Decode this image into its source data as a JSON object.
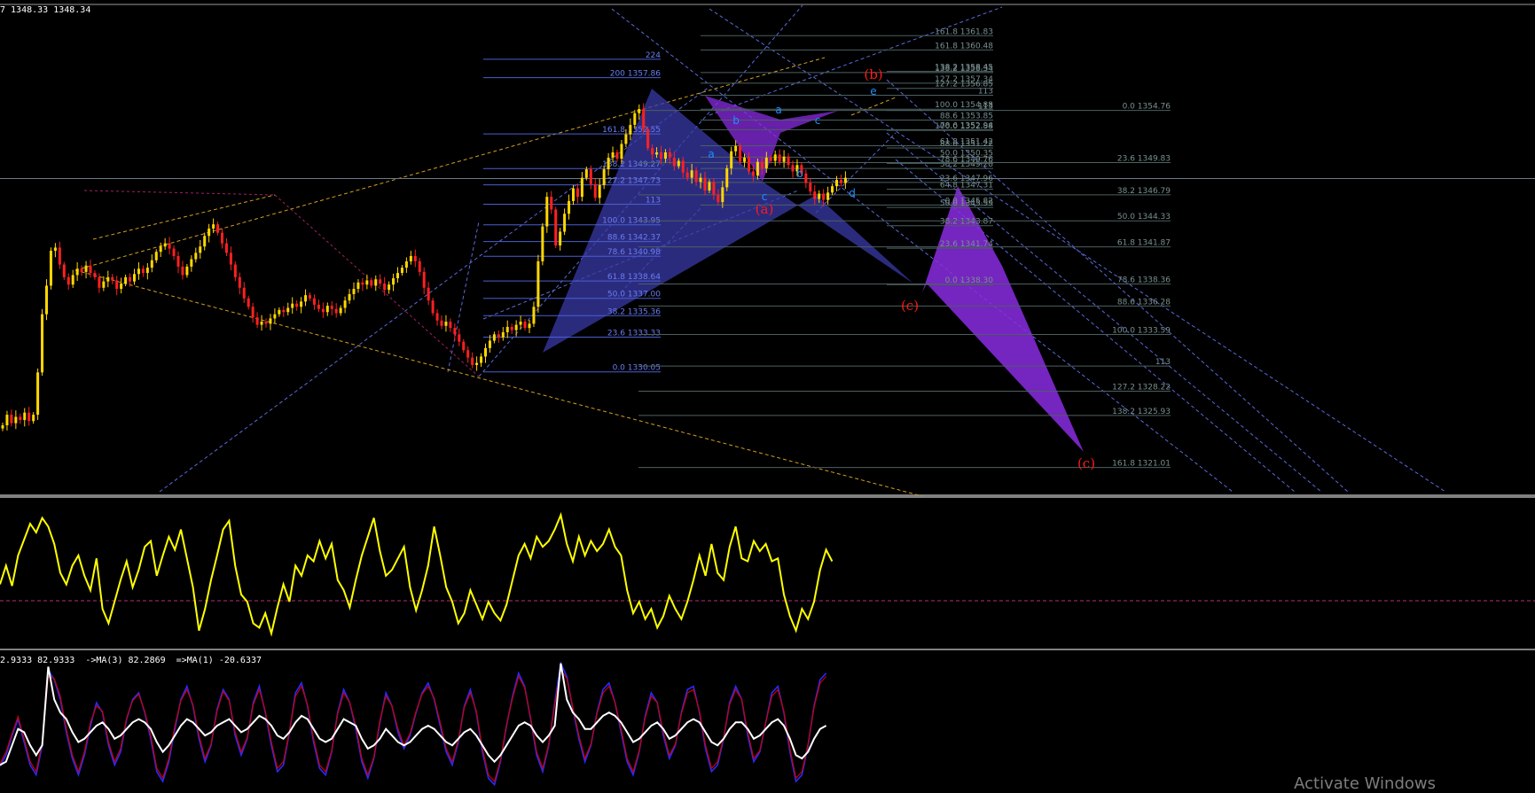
{
  "window": {
    "main_header": "7 1348.33 1348.34",
    "sub2_header": "2.9333 82.9333  ->MA(3) 82.2869  =>MA(1) -20.6337",
    "watermark": "Activate Windows"
  },
  "colors": {
    "background": "#000000",
    "candle_up": "#ffd700",
    "candle_down": "#ff2020",
    "fib_blue": "#4a5fd0",
    "fib_gray": "#4c6060",
    "wave_red": "#ff1a1a",
    "pattern_label": "#1e90ff",
    "harmonic_blue": "#3a3aa8",
    "harmonic_purple": "#8a2be2",
    "trend_orange": "#d4a020",
    "osc_yellow": "#ffff00",
    "osc2_white": "#ffffff",
    "osc2_blue": "#2a2aff",
    "osc2_red": "#c80000",
    "panel_separator": "#808080",
    "price_line": "#6b7a8a",
    "zero_line": "#b0307a"
  },
  "fib_set_1": [
    {
      "label": "224",
      "price": 1359.6
    },
    {
      "label": "200 1357.86",
      "price": 1357.86
    },
    {
      "label": "161.8 1352.55",
      "price": 1352.55
    },
    {
      "label": "138.2 1349.27",
      "price": 1349.27
    },
    {
      "label": "127.2 1347.73",
      "price": 1347.73
    },
    {
      "label": "113",
      "price": 1345.9
    },
    {
      "label": "100.0 1343.95",
      "price": 1343.95
    },
    {
      "label": "88.6 1342.37",
      "price": 1342.37
    },
    {
      "label": "78.6 1340.98",
      "price": 1340.98
    },
    {
      "label": "61.8 1338.64",
      "price": 1338.64
    },
    {
      "label": "50.0 1337.00",
      "price": 1337.0
    },
    {
      "label": "38.2 1335.36",
      "price": 1335.36
    },
    {
      "label": "23.6 1333.33",
      "price": 1333.33
    },
    {
      "label": "0.0 1330.05",
      "price": 1330.05
    }
  ],
  "fib_set_2": [
    {
      "label": "161.8 1361.83",
      "price": 1361.83
    },
    {
      "label": "161.8 1360.48",
      "price": 1360.48
    },
    {
      "label": "138.2 1358.34",
      "price": 1358.34
    },
    {
      "label": "127.2 1357.34",
      "price": 1357.34
    },
    {
      "label": "113",
      "price": 1356.2
    },
    {
      "label": "100.0 1354.88",
      "price": 1354.88
    },
    {
      "label": "88.6 1353.85",
      "price": 1353.85
    },
    {
      "label": "78.6 1352.94",
      "price": 1352.94
    },
    {
      "label": "61.8 1351.42",
      "price": 1351.42
    },
    {
      "label": "50.0 1350.35",
      "price": 1350.35
    },
    {
      "label": "38.2 1349.28",
      "price": 1349.28
    },
    {
      "label": "23.6 1347.96",
      "price": 1347.96
    },
    {
      "label": "0.0 1345.82",
      "price": 1345.82
    }
  ],
  "fib_set_3": [
    {
      "label": "138.2 1358.45",
      "price": 1358.45
    },
    {
      "label": "127.2 1356.85",
      "price": 1356.85
    },
    {
      "label": "113",
      "price": 1354.76
    },
    {
      "label": "100.0 1352.88",
      "price": 1352.88
    },
    {
      "label": "88.6 1351.22",
      "price": 1351.22
    },
    {
      "label": "78.6 1349.76",
      "price": 1349.76
    },
    {
      "label": "64.8 1347.31",
      "price": 1347.31
    },
    {
      "label": "50.0 1345.59",
      "price": 1345.59
    },
    {
      "label": "38.2 1343.87",
      "price": 1343.87
    },
    {
      "label": "23.6 1341.74",
      "price": 1341.74
    },
    {
      "label": "0.0 1338.30",
      "price": 1338.3
    }
  ],
  "fib_set_4": [
    {
      "label": "0.0 1354.76",
      "price": 1354.76
    },
    {
      "label": "23.6 1349.83",
      "price": 1349.83
    },
    {
      "label": "38.2 1346.79",
      "price": 1346.79
    },
    {
      "label": "50.0 1344.33",
      "price": 1344.33
    },
    {
      "label": "61.8 1341.87",
      "price": 1341.87
    },
    {
      "label": "78.6 1338.36",
      "price": 1338.36
    },
    {
      "label": "88.6 1336.28",
      "price": 1336.28
    },
    {
      "label": "100.0 1333.59",
      "price": 1333.59
    },
    {
      "label": "113",
      "price": 1330.6
    },
    {
      "label": "127.2 1328.22",
      "price": 1328.22
    },
    {
      "label": "138.2 1325.93",
      "price": 1325.93
    },
    {
      "label": "161.8 1321.01",
      "price": 1321.01
    }
  ],
  "wave_labels": [
    "(a)",
    "(b)",
    "(c)",
    "(c)"
  ],
  "pattern_labels": [
    "a",
    "b",
    "c",
    "d",
    "e",
    "a",
    "b",
    "c"
  ],
  "chart_data": [
    {
      "type": "candlestick",
      "title": "",
      "ylim": [
        1318.3,
        1364.7
      ],
      "current_price": 1348.33,
      "series": [
        {
          "values": [
            1325.0,
            1326.0,
            1325.2,
            1325.8,
            1325.5,
            1326.2,
            1325.4,
            1326.0,
            1330.0,
            1335.5,
            1338.2,
            1341.5,
            1341.8,
            1340.2,
            1339.0,
            1338.3,
            1339.2,
            1339.8,
            1339.5,
            1340.1,
            1339.4,
            1339.0,
            1338.0,
            1338.6,
            1339.0,
            1338.7,
            1337.9,
            1338.4,
            1339.0,
            1338.6,
            1339.3,
            1339.8,
            1339.4,
            1339.9,
            1340.6,
            1341.4,
            1341.9,
            1342.2,
            1341.7,
            1341.0,
            1340.0,
            1339.2,
            1340.0,
            1340.7,
            1341.3,
            1341.9,
            1342.9,
            1343.6,
            1344.0,
            1343.2,
            1342.2,
            1341.3,
            1340.2,
            1339.0,
            1338.0,
            1337.0,
            1336.2,
            1335.2,
            1334.5,
            1334.8,
            1334.6,
            1335.1,
            1335.5,
            1335.9,
            1335.7,
            1336.1,
            1336.5,
            1336.2,
            1336.7,
            1337.3,
            1337.0,
            1336.4,
            1336.0,
            1335.7,
            1336.3,
            1336.0,
            1335.6,
            1336.1,
            1336.8,
            1337.4,
            1337.9,
            1338.5,
            1338.3,
            1338.7,
            1338.2,
            1338.8,
            1338.4,
            1337.8,
            1338.3,
            1338.9,
            1339.4,
            1339.9,
            1340.5,
            1341.0,
            1340.5,
            1339.5,
            1338.0,
            1336.8,
            1335.6,
            1334.9,
            1334.4,
            1334.8,
            1334.2,
            1333.6,
            1332.9,
            1332.1,
            1331.4,
            1330.7,
            1330.9,
            1331.5,
            1332.3,
            1333.0,
            1333.6,
            1333.3,
            1333.8,
            1334.3,
            1334.0,
            1334.5,
            1334.8,
            1334.2,
            1334.6,
            1336.2,
            1340.5,
            1343.8,
            1346.6,
            1345.4,
            1342.0,
            1343.3,
            1345.0,
            1346.2,
            1347.4,
            1346.6,
            1348.4,
            1349.2,
            1347.8,
            1346.5,
            1347.7,
            1349.2,
            1350.3,
            1350.8,
            1350.2,
            1351.6,
            1352.5,
            1353.4,
            1354.5,
            1354.9,
            1353.0,
            1351.2,
            1350.6,
            1350.8,
            1350.2,
            1350.8,
            1350.3,
            1349.5,
            1350.0,
            1348.9,
            1348.4,
            1349.1,
            1348.0,
            1348.4,
            1347.2,
            1348.0,
            1346.8,
            1346.1,
            1347.5,
            1349.3,
            1350.9,
            1351.4,
            1349.9,
            1350.3,
            1349.0,
            1348.6,
            1349.9,
            1349.3,
            1350.3,
            1350.0,
            1350.6,
            1349.9,
            1350.4,
            1349.6,
            1349.0,
            1349.6,
            1348.8,
            1347.9,
            1347.1,
            1346.4,
            1346.9,
            1346.3,
            1347.0,
            1347.6,
            1348.2,
            1347.9,
            1348.4
          ]
        }
      ]
    },
    {
      "type": "line",
      "title": "",
      "ylim": [
        0,
        100
      ],
      "series": [
        {
          "values": [
            42.0,
            55.0,
            41.0,
            62.0,
            73.0,
            84.0,
            78.0,
            88.0,
            82.0,
            70.0,
            50.0,
            42.0,
            55.0,
            62.0,
            48.0,
            38.0,
            60.0,
            25.0,
            15.0,
            30.0,
            45.0,
            58.0,
            40.0,
            52.0,
            68.0,
            72.0,
            48.0,
            62.0,
            75.0,
            66.0,
            80.0,
            60.0,
            40.0,
            10.0,
            25.0,
            45.0,
            62.0,
            80.0,
            86.0,
            55.0,
            35.0,
            30.0,
            15.0,
            12.0,
            22.0,
            8.0,
            26.0,
            42.0,
            30.0,
            55.0,
            48.0,
            62.0,
            58.0,
            72.0,
            60.0,
            70.0,
            45.0,
            38.0,
            26.0,
            45.0,
            62.0,
            75.0,
            88.0,
            65.0,
            48.0,
            52.0,
            60.0,
            68.0,
            40.0,
            24.0,
            38.0,
            55.0,
            82.0,
            62.0,
            40.0,
            30.0,
            15.0,
            22.0,
            38.0,
            28.0,
            18.0,
            30.0,
            22.0,
            17.0,
            28.0,
            45.0,
            62.0,
            70.0,
            60.0,
            75.0,
            68.0,
            72.0,
            80.0,
            90.0,
            70.0,
            58.0,
            75.0,
            62.0,
            72.0,
            65.0,
            70.0,
            80.0,
            68.0,
            62.0,
            38.0,
            22.0,
            30.0,
            18.0,
            25.0,
            12.0,
            20.0,
            34.0,
            25.0,
            18.0,
            30.0,
            45.0,
            62.0,
            48.0,
            70.0,
            50.0,
            45.0,
            68.0,
            82.0,
            60.0,
            58.0,
            72.0,
            65.0,
            70.0,
            58.0,
            60.0,
            35.0,
            20.0,
            10.0,
            25.0,
            18.0,
            30.0,
            52.0,
            66.0,
            58.0
          ]
        }
      ]
    },
    {
      "type": "line",
      "title": "",
      "ylim": [
        -100,
        100
      ],
      "series": [
        {
          "values": [
            -62.0,
            -45.0,
            -15.0,
            10.0,
            -25.0,
            -60.0,
            -75.0,
            -30.0,
            85.0,
            70.0,
            40.0,
            -10.0,
            -50.0,
            -75.0,
            -45.0,
            0.0,
            35.0,
            20.0,
            -30.0,
            -60.0,
            -40.0,
            10.0,
            40.0,
            50.0,
            20.0,
            -20.0,
            -70.0,
            -85.0,
            -55.0,
            -5.0,
            40.0,
            60.0,
            30.0,
            -20.0,
            -55.0,
            -30.0,
            25.0,
            55.0,
            40.0,
            -15.0,
            -45.0,
            -20.0,
            35.0,
            60.0,
            20.0,
            -30.0,
            -70.0,
            -60.0,
            -10.0,
            50.0,
            65.0,
            30.0,
            -25.0,
            -65.0,
            -75.0,
            -40.0,
            20.0,
            55.0,
            35.0,
            -5.0,
            -55.0,
            -80.0,
            -50.0,
            5.0,
            50.0,
            30.0,
            -10.0,
            -35.0,
            -15.0,
            20.0,
            50.0,
            65.0,
            40.0,
            0.0,
            -40.0,
            -60.0,
            -25.0,
            30.0,
            55.0,
            20.0,
            -40.0,
            -80.0,
            -90.0,
            -55.0,
            0.0,
            45.0,
            80.0,
            60.0,
            10.0,
            -45.0,
            -70.0,
            -30.0,
            35.0,
            95.0,
            75.0,
            25.0,
            -20.0,
            -55.0,
            -30.0,
            20.0,
            55.0,
            65.0,
            35.0,
            -10.0,
            -55.0,
            -75.0,
            -40.0,
            15.0,
            50.0,
            35.0,
            -15.0,
            -50.0,
            -30.0,
            20.0,
            55.0,
            60.0,
            20.0,
            -35.0,
            -70.0,
            -60.0,
            -20.0,
            35.0,
            60.0,
            40.0,
            -15.0,
            -55.0,
            -40.0,
            5.0,
            50.0,
            60.0,
            20.0,
            -40.0,
            -85.0,
            -75.0,
            -30.0,
            30.0,
            70.0,
            80.0
          ]
        },
        {
          "values": [
            -58.0,
            -40.0,
            -12.0,
            14.0,
            -20.0,
            -55.0,
            -70.0,
            -25.0,
            75.0,
            72.0,
            45.0,
            -5.0,
            -45.0,
            -70.0,
            -40.0,
            5.0,
            30.0,
            22.0,
            -25.0,
            -55.0,
            -35.0,
            12.0,
            38.0,
            48.0,
            22.0,
            -15.0,
            -65.0,
            -80.0,
            -50.0,
            0.0,
            38.0,
            55.0,
            32.0,
            -15.0,
            -50.0,
            -28.0,
            22.0,
            52.0,
            38.0,
            -10.0,
            -40.0,
            -18.0,
            32.0,
            55.0,
            22.0,
            -25.0,
            -65.0,
            -55.0,
            -8.0,
            45.0,
            60.0,
            32.0,
            -20.0,
            -60.0,
            -70.0,
            -38.0,
            18.0,
            50.0,
            35.0,
            0.0,
            -50.0,
            -75.0,
            -48.0,
            8.0,
            45.0,
            30.0,
            -5.0,
            -30.0,
            -12.0,
            22.0,
            48.0,
            60.0,
            42.0,
            5.0,
            -35.0,
            -55.0,
            -22.0,
            28.0,
            50.0,
            22.0,
            -35.0,
            -75.0,
            -85.0,
            -52.0,
            2.0,
            42.0,
            75.0,
            58.0,
            12.0,
            -40.0,
            -65.0,
            -28.0,
            32.0,
            85.0,
            72.0,
            28.0,
            -15.0,
            -50.0,
            -28.0,
            18.0,
            50.0,
            60.0,
            35.0,
            -5.0,
            -50.0,
            -70.0,
            -38.0,
            12.0,
            45.0,
            35.0,
            -10.0,
            -45.0,
            -28.0,
            18.0,
            50.0,
            55.0,
            22.0,
            -30.0,
            -65.0,
            -55.0,
            -18.0,
            32.0,
            55.0,
            40.0,
            -10.0,
            -50.0,
            -38.0,
            5.0,
            45.0,
            55.0,
            22.0,
            -35.0,
            -80.0,
            -70.0,
            -28.0,
            28.0,
            65.0,
            75.0
          ]
        },
        {
          "values": [
            -60.0,
            -55.0,
            -30.0,
            -5.0,
            -10.0,
            -30.0,
            -45.0,
            -30.0,
            90.0,
            40.0,
            20.0,
            10.0,
            -10.0,
            -25.0,
            -20.0,
            -10.0,
            0.0,
            5.0,
            -5.0,
            -20.0,
            -15.0,
            -5.0,
            5.0,
            10.0,
            5.0,
            -5.0,
            -25.0,
            -40.0,
            -30.0,
            -15.0,
            0.0,
            10.0,
            5.0,
            -5.0,
            -15.0,
            -10.0,
            0.0,
            5.0,
            10.0,
            0.0,
            -10.0,
            -5.0,
            5.0,
            15.0,
            10.0,
            0.0,
            -15.0,
            -20.0,
            -10.0,
            5.0,
            15.0,
            10.0,
            -5.0,
            -20.0,
            -25.0,
            -20.0,
            -5.0,
            10.0,
            5.0,
            0.0,
            -20.0,
            -35.0,
            -30.0,
            -20.0,
            -5.0,
            -15.0,
            -25.0,
            -30.0,
            -25.0,
            -15.0,
            -5.0,
            0.0,
            -5.0,
            -15.0,
            -25.0,
            -30.0,
            -20.0,
            -10.0,
            -5.0,
            -15.0,
            -30.0,
            -45.0,
            -55.0,
            -45.0,
            -30.0,
            -15.0,
            0.0,
            5.0,
            0.0,
            -15.0,
            -25.0,
            -15.0,
            0.0,
            95.0,
            40.0,
            20.0,
            10.0,
            -5.0,
            -5.0,
            5.0,
            15.0,
            20.0,
            15.0,
            5.0,
            -10.0,
            -25.0,
            -20.0,
            -10.0,
            0.0,
            5.0,
            -5.0,
            -20.0,
            -15.0,
            -5.0,
            5.0,
            10.0,
            5.0,
            -10.0,
            -25.0,
            -30.0,
            -20.0,
            -5.0,
            5.0,
            5.0,
            -5.0,
            -20.0,
            -15.0,
            -5.0,
            5.0,
            10.0,
            0.0,
            -20.0,
            -45.0,
            -50.0,
            -40.0,
            -20.0,
            -5.0,
            0.0
          ]
        }
      ]
    }
  ]
}
